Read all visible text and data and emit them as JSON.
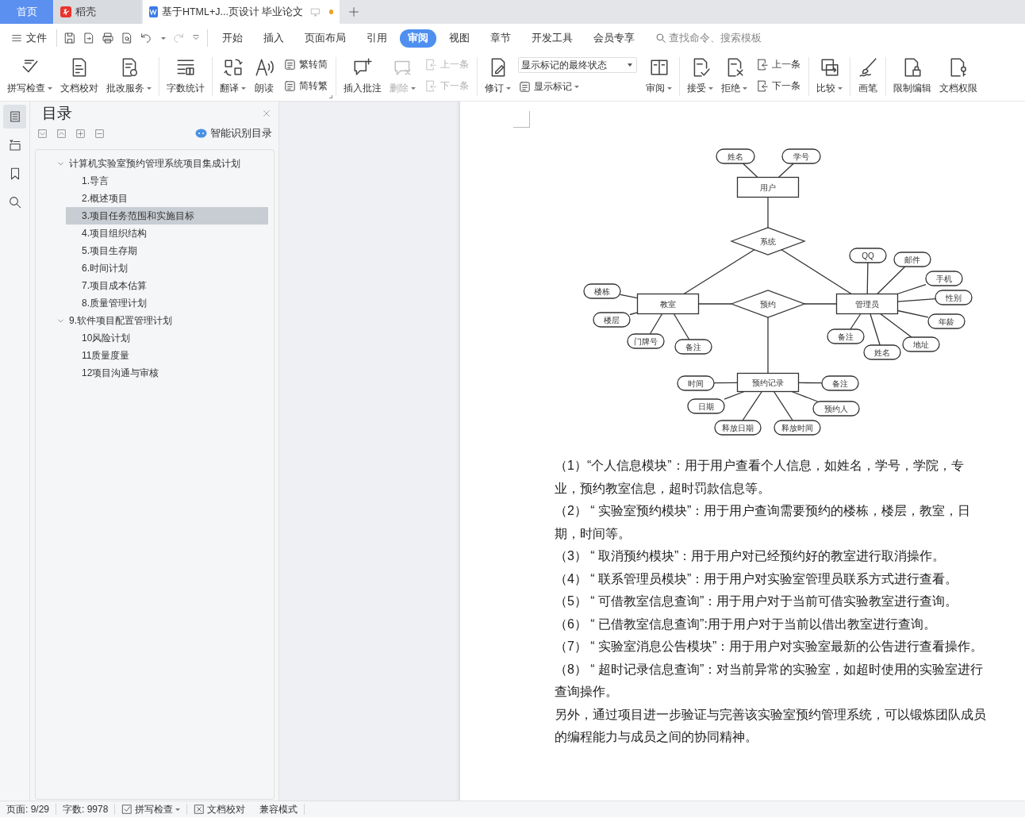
{
  "title_tabs": [
    {
      "label": "首页",
      "kind": "home",
      "selected": false
    },
    {
      "label": "稻壳",
      "kind": "app",
      "selected": false
    },
    {
      "label": "基于HTML+J...页设计 毕业论文",
      "kind": "document",
      "selected": true,
      "unsaved": true
    }
  ],
  "menu": {
    "file": "文件",
    "tabs": [
      {
        "label": "开始",
        "selected": false
      },
      {
        "label": "插入",
        "selected": false
      },
      {
        "label": "页面布局",
        "selected": false
      },
      {
        "label": "引用",
        "selected": false
      },
      {
        "label": "审阅",
        "selected": true
      },
      {
        "label": "视图",
        "selected": false
      },
      {
        "label": "章节",
        "selected": false
      },
      {
        "label": "开发工具",
        "selected": false
      },
      {
        "label": "会员专享",
        "selected": false
      }
    ],
    "search": {
      "placeholder": "查找命令、搜索模板"
    }
  },
  "ribbon": [
    [
      {
        "kind": "big",
        "label": "拼写检查",
        "dropdown": true,
        "disabled": false
      },
      {
        "kind": "big",
        "label": "文档校对",
        "dropdown": false,
        "disabled": false
      },
      {
        "kind": "big",
        "label": "批改服务",
        "dropdown": true,
        "disabled": false
      }
    ],
    [
      {
        "kind": "big",
        "label": "字数统计",
        "dropdown": false,
        "disabled": false
      }
    ],
    [
      {
        "kind": "big",
        "label": "翻译",
        "dropdown": true,
        "disabled": false
      },
      {
        "kind": "big",
        "label": "朗读",
        "dropdown": false,
        "disabled": false
      },
      {
        "kind": "stack",
        "items": [
          {
            "label": "繁转简",
            "disabled": false
          },
          {
            "label": "简转繁",
            "disabled": false
          }
        ]
      }
    ],
    [
      {
        "kind": "big",
        "label": "插入批注",
        "dropdown": false,
        "disabled": false
      },
      {
        "kind": "big",
        "label": "删除",
        "dropdown": true,
        "disabled": true
      },
      {
        "kind": "stack",
        "items": [
          {
            "label": "上一条",
            "disabled": true
          },
          {
            "label": "下一条",
            "disabled": true
          }
        ]
      }
    ],
    [
      {
        "kind": "big",
        "label": "修订",
        "dropdown": true,
        "disabled": false
      },
      {
        "kind": "select",
        "value": "显示标记的最终状态",
        "label": "显示标记",
        "dropdown": true
      },
      {
        "kind": "big",
        "label": "审阅",
        "dropdown": true,
        "disabled": false
      }
    ],
    [
      {
        "kind": "big",
        "label": "接受",
        "dropdown": true,
        "disabled": false
      },
      {
        "kind": "big",
        "label": "拒绝",
        "dropdown": true,
        "disabled": false
      },
      {
        "kind": "stack",
        "items": [
          {
            "label": "上一条",
            "disabled": false
          },
          {
            "label": "下一条",
            "disabled": false
          }
        ]
      }
    ],
    [
      {
        "kind": "big",
        "label": "比较",
        "dropdown": true,
        "disabled": false
      }
    ],
    [
      {
        "kind": "big",
        "label": "画笔",
        "dropdown": false,
        "disabled": false
      }
    ],
    [
      {
        "kind": "big",
        "label": "限制编辑",
        "dropdown": false,
        "disabled": false
      },
      {
        "kind": "big",
        "label": "文档权限",
        "dropdown": false,
        "disabled": false
      }
    ]
  ],
  "outline": {
    "title": "目录",
    "action": "智能识别目录",
    "items": [
      {
        "label": "计算机实验室预约管理系统项目集成计划",
        "expanded": true,
        "selected": false,
        "children": [
          {
            "label": "1.导言",
            "selected": false
          },
          {
            "label": "2.概述项目",
            "selected": false
          },
          {
            "label": "3.项目任务范围和实施目标",
            "selected": true
          },
          {
            "label": "4.项目组织结构",
            "selected": false
          },
          {
            "label": "5.项目生存期",
            "selected": false
          },
          {
            "label": "6.时间计划",
            "selected": false
          },
          {
            "label": "7.项目成本估算",
            "selected": false
          },
          {
            "label": "8.质量管理计划",
            "selected": false
          }
        ]
      },
      {
        "label": "9.软件项目配置管理计划",
        "expanded": true,
        "selected": false,
        "children": [
          {
            "label": "10风险计划",
            "selected": false
          },
          {
            "label": "11质量度量",
            "selected": false
          },
          {
            "label": "12项目沟通与审核",
            "selected": false
          }
        ]
      }
    ]
  },
  "document": {
    "diagram": {
      "nodes": [
        {
          "label": "姓名",
          "kind": "attribute"
        },
        {
          "label": "学号",
          "kind": "attribute"
        },
        {
          "label": "用户",
          "kind": "entity"
        },
        {
          "label": "系统",
          "kind": "relationship"
        },
        {
          "label": "QQ",
          "kind": "attribute"
        },
        {
          "label": "邮件",
          "kind": "attribute"
        },
        {
          "label": "手机",
          "kind": "attribute"
        },
        {
          "label": "楼栋",
          "kind": "attribute"
        },
        {
          "label": "性别",
          "kind": "attribute"
        },
        {
          "label": "教室",
          "kind": "entity"
        },
        {
          "label": "预约",
          "kind": "relationship"
        },
        {
          "label": "管理员",
          "kind": "entity"
        },
        {
          "label": "楼层",
          "kind": "attribute"
        },
        {
          "label": "年龄",
          "kind": "attribute"
        },
        {
          "label": "门牌号",
          "kind": "attribute"
        },
        {
          "label": "备注",
          "kind": "attribute"
        },
        {
          "label": "备注",
          "kind": "attribute"
        },
        {
          "label": "姓名",
          "kind": "attribute"
        },
        {
          "label": "地址",
          "kind": "attribute"
        },
        {
          "label": "时间",
          "kind": "attribute"
        },
        {
          "label": "预约记录",
          "kind": "entity"
        },
        {
          "label": "备注",
          "kind": "attribute"
        },
        {
          "label": "日期",
          "kind": "attribute"
        },
        {
          "label": "预约人",
          "kind": "attribute"
        },
        {
          "label": "释放日期",
          "kind": "attribute"
        },
        {
          "label": "释放时间",
          "kind": "attribute"
        }
      ]
    },
    "paragraphs": [
      "（1）“个人信息模块”：用于用户查看个人信息，如姓名，学号，学院，专业，预约教室信息，超时罚款信息等。",
      "（2） “ 实验室预约模块”：用于用户查询需要预约的楼栋，楼层，教室，日期，时间等。",
      "（3） “ 取消预约模块”：用于用户对已经预约好的教室进行取消操作。",
      "（4） “ 联系管理员模块”：用于用户对实验室管理员联系方式进行查看。",
      "（5） “ 可借教室信息查询”：用于用户对于当前可借实验教室进行查询。",
      "（6） “ 已借教室信息查询”:用于用户对于当前以借出教室进行查询。",
      "（7） “ 实验室消息公告模块”：用于用户对实验室最新的公告进行查看操作。",
      "（8） “ 超时记录信息查询”：对当前异常的实验室，如超时使用的实验室进行查询操作。",
      "另外，通过项目进一步验证与完善该实验室预约管理系统，可以锻炼团队成员的编程能力与成员之间的协同精神。"
    ]
  },
  "status_bar": {
    "page": "页面: 9/29",
    "words": "字数: 9978",
    "spell_check": "拼写检查",
    "proofread": "文档校对",
    "mode": "兼容模式"
  }
}
